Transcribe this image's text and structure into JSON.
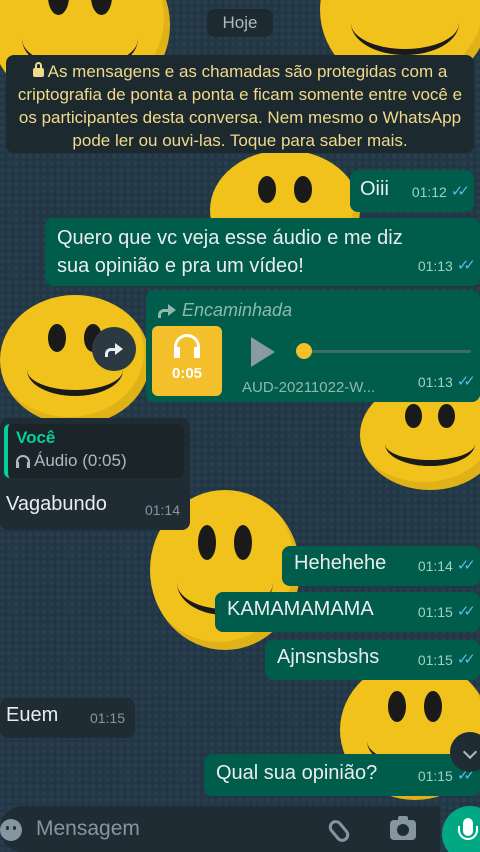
{
  "date_chip": "Hoje",
  "encryption_notice": "As mensagens e as chamadas são protegidas com a criptografia de ponta a ponta e ficam somente entre você e os participantes desta conversa. Nem mesmo o WhatsApp pode ler ou ouvi-las. Toque para saber mais.",
  "messages": [
    {
      "text": "Oiii",
      "time": "01:12"
    },
    {
      "text_line1": "Quero que vc veja esse áudio e me diz",
      "text_line2": "sua opinião e pra um vídeo!",
      "time": "01:13"
    },
    {
      "forwarded_label": "Encaminhada",
      "audio_duration": "0:05",
      "audio_name": "AUD-20211022-W...",
      "time": "01:13"
    },
    {
      "quote_author": "Você",
      "quote_text": "Áudio (0:05)",
      "text": "Vagabundo",
      "time": "01:14"
    },
    {
      "text": "Hehehehe",
      "time": "01:14"
    },
    {
      "text": "KAMAMAMAMA",
      "time": "01:15"
    },
    {
      "text": "Ajnsnsbshs",
      "time": "01:15"
    },
    {
      "text": "Euem",
      "time": "01:15"
    },
    {
      "text": "Qual sua opinião?",
      "time": "01:15"
    }
  ],
  "input": {
    "placeholder": "Mensagem"
  },
  "colors": {
    "outgoing": "#005c4b",
    "incoming": "#202c33",
    "read_ticks": "#53bdeb",
    "accent": "#00a884"
  }
}
